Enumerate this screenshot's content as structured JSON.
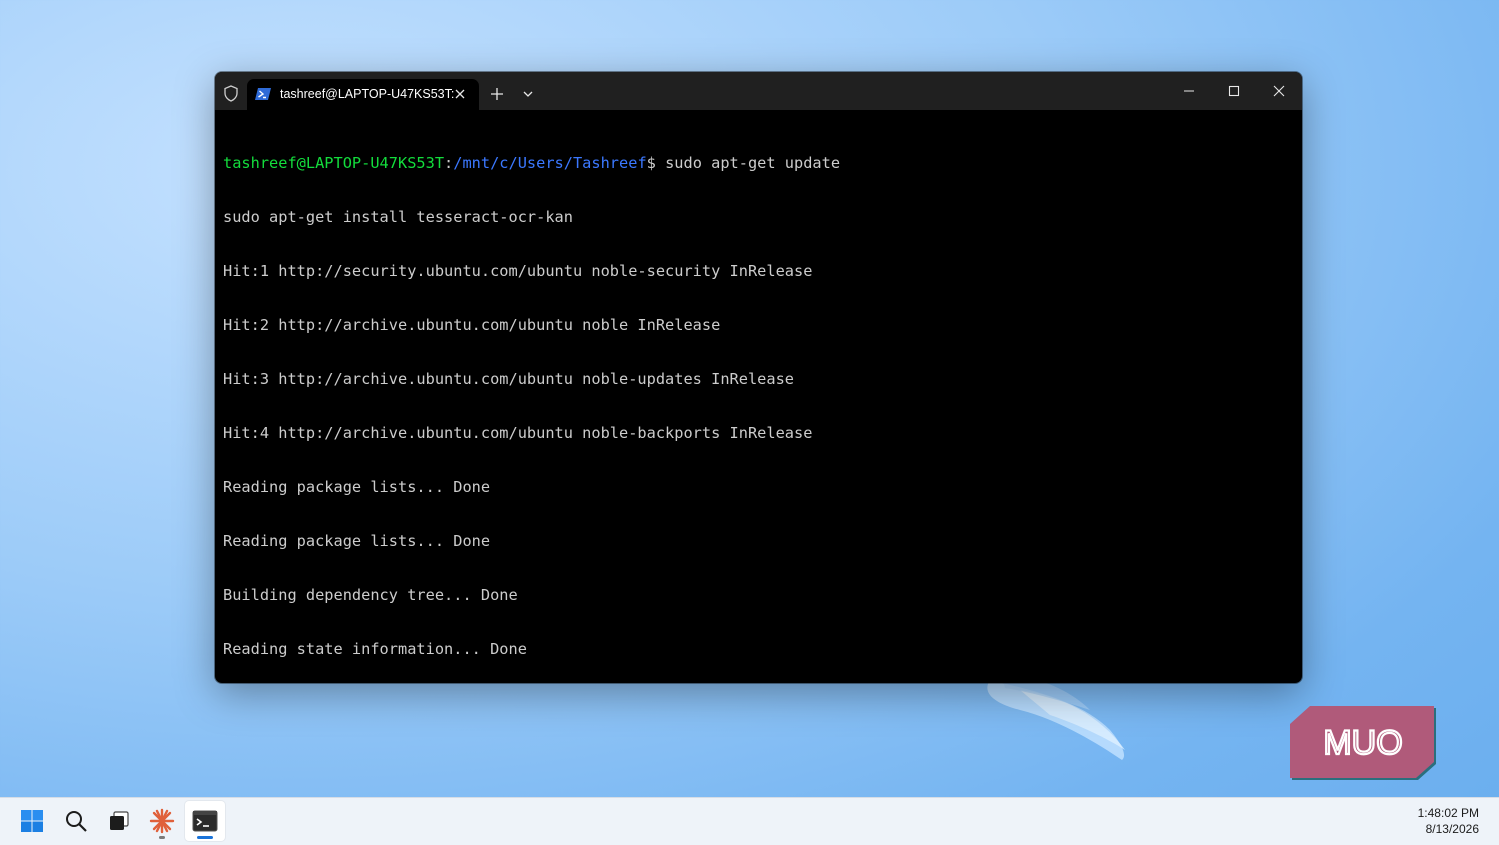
{
  "window": {
    "tab_title": "tashreef@LAPTOP-U47KS53T:"
  },
  "terminal": {
    "prompt_user": "tashreef@LAPTOP-U47KS53T",
    "prompt_sep": ":",
    "prompt_path": "/mnt/c/Users/Tashreef",
    "prompt_symbol": "$ ",
    "command": "sudo apt-get update",
    "lines": [
      "sudo apt-get install tesseract-ocr-kan",
      "Hit:1 http://security.ubuntu.com/ubuntu noble-security InRelease",
      "Hit:2 http://archive.ubuntu.com/ubuntu noble InRelease",
      "Hit:3 http://archive.ubuntu.com/ubuntu noble-updates InRelease",
      "Hit:4 http://archive.ubuntu.com/ubuntu noble-backports InRelease",
      "Reading package lists... Done",
      "Reading package lists... Done",
      "Building dependency tree... Done",
      "Reading state information... Done"
    ]
  },
  "watermark": {
    "text": "MUO"
  },
  "taskbar": {
    "time": "1:48:02 PM",
    "date": "8/13/2026"
  },
  "colors": {
    "prompt_user": "#13dc3c",
    "prompt_path": "#3b78ff",
    "terminal_bg": "#000000",
    "terminal_fg": "#cccccc",
    "titlebar_bg": "#202020",
    "muo_badge": "#b05a7a"
  }
}
